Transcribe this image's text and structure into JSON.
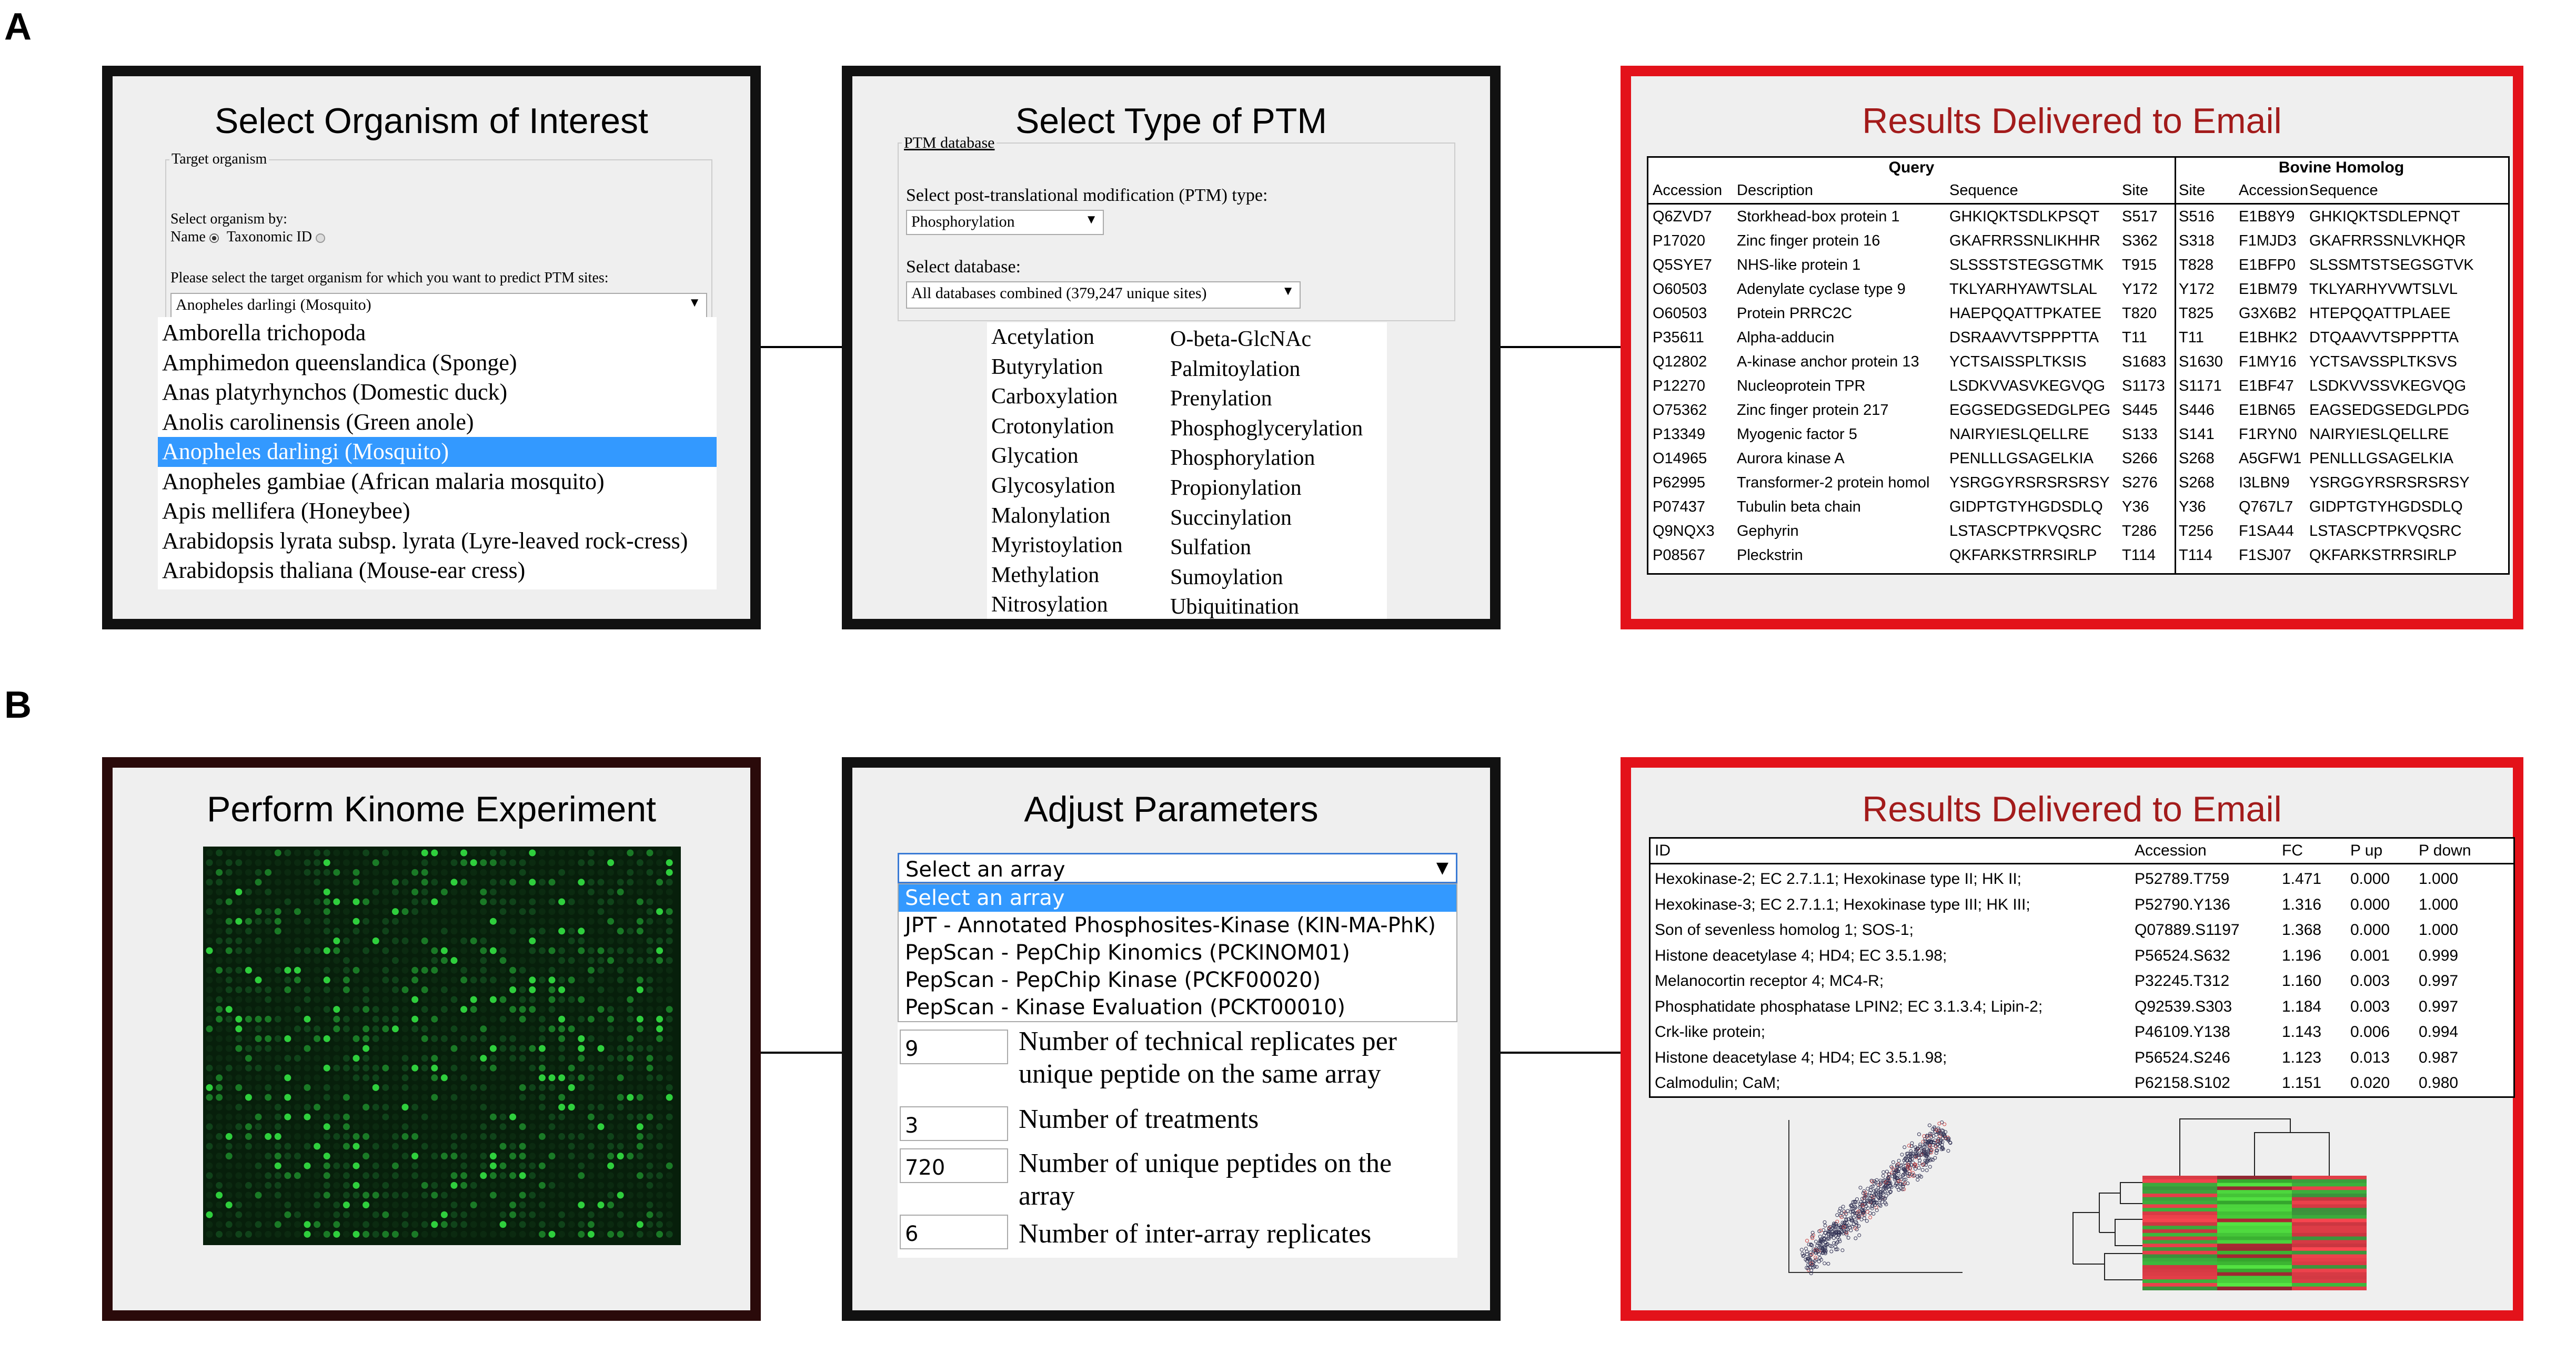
{
  "panel_labels": {
    "a": "A",
    "b": "B"
  },
  "colors": {
    "dark_border": "#111111",
    "maroon_border": "#2a0a0a",
    "red_border": "#e3121a",
    "title_red": "#a31b1b",
    "highlight": "#3399ff",
    "panel_bg": "#efefef"
  },
  "a1": {
    "title": "Select Organism of Interest",
    "legend": "Target organism",
    "select_by_label": "Select organism by:",
    "radio_name": "Name",
    "radio_taxonomic": "Taxonomic ID",
    "prompt": "Please select the target organism for which you want to predict PTM sites:",
    "selected_value": "Anopheles darlingi (Mosquito)",
    "options": [
      "Amborella trichopoda",
      "Amphimedon queenslandica (Sponge)",
      "Anas platyrhynchos (Domestic duck)",
      "Anolis carolinensis (Green anole)",
      "Anopheles darlingi (Mosquito)",
      "Anopheles gambiae (African malaria mosquito)",
      "Apis mellifera (Honeybee)",
      "Arabidopsis lyrata subsp. lyrata (Lyre-leaved rock-cress)",
      "Arabidopsis thaliana (Mouse-ear cress)"
    ]
  },
  "a2": {
    "title": "Select Type of PTM",
    "legend": "PTM database",
    "ptm_prompt": "Select post-translational modification (PTM) type:",
    "ptm_selected": "Phosphorylation",
    "db_prompt": "Select database:",
    "db_selected": "All databases combined (379,247 unique sites)",
    "col1": [
      "Acetylation",
      "Butyrylation",
      "Carboxylation",
      "Crotonylation",
      "Glycation",
      "Glycosylation",
      "Malonylation",
      "Myristoylation",
      "Methylation",
      "Nitrosylation"
    ],
    "col2": [
      "O-beta-GlcNAc",
      "Palmitoylation",
      "Prenylation",
      "Phosphoglycerylation",
      "Phosphorylation",
      "Propionylation",
      "Succinylation",
      "Sulfation",
      "Sumoylation",
      "Ubiquitination"
    ]
  },
  "a3": {
    "title": "Results Delivered to Email",
    "group_query": "Query",
    "group_bovine": "Bovine Homolog",
    "headers": [
      "Accession",
      "Description",
      "Sequence",
      "Site",
      "Site",
      "Accession",
      "Sequence"
    ],
    "rows": [
      [
        "Q6ZVD7",
        "Storkhead-box protein 1",
        "GHKIQKTSDLKPSQT",
        "S517",
        "S516",
        "E1B8Y9",
        "GHKIQKTSDLEPNQT"
      ],
      [
        "P17020",
        "Zinc finger protein 16",
        "GKAFRRSSNLIKHHR",
        "S362",
        "S318",
        "F1MJD3",
        "GKAFRRSSNLVKHQR"
      ],
      [
        "Q5SYE7",
        "NHS-like protein 1",
        "SLSSSTSTEGSGTMK",
        "T915",
        "T828",
        "E1BFP0",
        "SLSSMTSTSEGSGTVK"
      ],
      [
        "O60503",
        "Adenylate cyclase type 9",
        "TKLYARHYAWTSLAL",
        "Y172",
        "Y172",
        "E1BM79",
        "TKLYARHYVWTSLVL"
      ],
      [
        "O60503",
        "Protein PRRC2C",
        "HAEPQQATTPKATEE",
        "T820",
        "T825",
        "G3X6B2",
        "HTEPQQATTPLAEE"
      ],
      [
        "P35611",
        "Alpha-adducin",
        "DSRAAVVTSPPPTTA",
        "T11",
        "T11",
        "E1BHK2",
        "DTQAAVVTSPPPTTA"
      ],
      [
        "Q12802",
        "A-kinase anchor protein 13",
        "YCTSAISSPLTKSIS",
        "S1683",
        "S1630",
        "F1MY16",
        "YCTSAVSSPLTKSVS"
      ],
      [
        "P12270",
        "Nucleoprotein TPR",
        "LSDKVVASVKEGVQG",
        "S1173",
        "S1171",
        "E1BF47",
        "LSDKVVSSVKEGVQG"
      ],
      [
        "O75362",
        "Zinc finger protein 217",
        "EGGSEDGSEDGLPEG",
        "S445",
        "S446",
        "E1BN65",
        "EAGSEDGSEDGLPDG"
      ],
      [
        "P13349",
        "Myogenic factor 5",
        "NAIRYIESLQELLRE",
        "S133",
        "S141",
        "F1RYN0",
        "NAIRYIESLQELLRE"
      ],
      [
        "O14965",
        "Aurora kinase A",
        "PENLLLGSAGELKIA",
        "S266",
        "S268",
        "A5GFW1",
        "PENLLLGSAGELKIA"
      ],
      [
        "P62995",
        "Transformer-2 protein homol",
        "YSRGGYRSRSRSRSY",
        "S276",
        "S268",
        "I3LBN9",
        "YSRGGYRSRSRSRSY"
      ],
      [
        "P07437",
        "Tubulin beta chain",
        "GIDPTGTYHGDSDLQ",
        "Y36",
        "Y36",
        "Q767L7",
        "GIDPTGTYHGDSDLQ"
      ],
      [
        "Q9NQX3",
        "Gephyrin",
        "LSTASCPTPKVQSRC",
        "T286",
        "T256",
        "F1SA44",
        "LSTASCPTPKVQSRC"
      ],
      [
        "P08567",
        "Pleckstrin",
        "QKFARKSTRRSIRLP",
        "T114",
        "T114",
        "F1SJ07",
        "QKFARKSTRRSIRLP"
      ]
    ]
  },
  "b1": {
    "title": "Perform Kinome Experiment"
  },
  "b2": {
    "title": "Adjust Parameters",
    "select_placeholder": "Select an array",
    "options": [
      "Select an array",
      "JPT - Annotated Phosphosites-Kinase (KIN-MA-PhK)",
      "PepScan - PepChip Kinomics (PCKINOM01)",
      "PepScan - PepChip Kinase (PCKF00020)",
      "PepScan - Kinase Evaluation (PCKT00010)"
    ],
    "params": [
      {
        "value": "9",
        "label": "Number of technical replicates per unique peptide on the same array"
      },
      {
        "value": "3",
        "label": "Number of treatments"
      },
      {
        "value": "720",
        "label": "Number of unique peptides on the array"
      },
      {
        "value": "6",
        "label": "Number of inter-array replicates"
      }
    ]
  },
  "b3": {
    "title": "Results Delivered to Email",
    "headers": [
      "ID",
      "Accession",
      "FC",
      "P up",
      "P down"
    ],
    "rows": [
      [
        "Hexokinase-2; EC 2.7.1.1; Hexokinase type II; HK II;",
        "P52789.T759",
        "1.471",
        "0.000",
        "1.000"
      ],
      [
        "Hexokinase-3; EC 2.7.1.1; Hexokinase type III; HK III;",
        "P52790.Y136",
        "1.316",
        "0.000",
        "1.000"
      ],
      [
        "Son of sevenless homolog 1; SOS-1;",
        "Q07889.S1197",
        "1.368",
        "0.000",
        "1.000"
      ],
      [
        "Histone deacetylase 4; HD4; EC 3.5.1.98;",
        "P56524.S632",
        "1.196",
        "0.001",
        "0.999"
      ],
      [
        "Melanocortin receptor 4; MC4-R;",
        "P32245.T312",
        "1.160",
        "0.003",
        "0.997"
      ],
      [
        "Phosphatidate phosphatase LPIN2; EC 3.1.3.4; Lipin-2;",
        "Q92539.S303",
        "1.184",
        "0.003",
        "0.997"
      ],
      [
        "Crk-like protein;",
        "P46109.Y138",
        "1.143",
        "0.006",
        "0.994"
      ],
      [
        "Histone deacetylase 4; HD4; EC 3.5.1.98;",
        "P56524.S246",
        "1.123",
        "0.013",
        "0.987"
      ],
      [
        "Calmodulin; CaM;",
        "P62158.S102",
        "1.151",
        "0.020",
        "0.980"
      ]
    ]
  }
}
